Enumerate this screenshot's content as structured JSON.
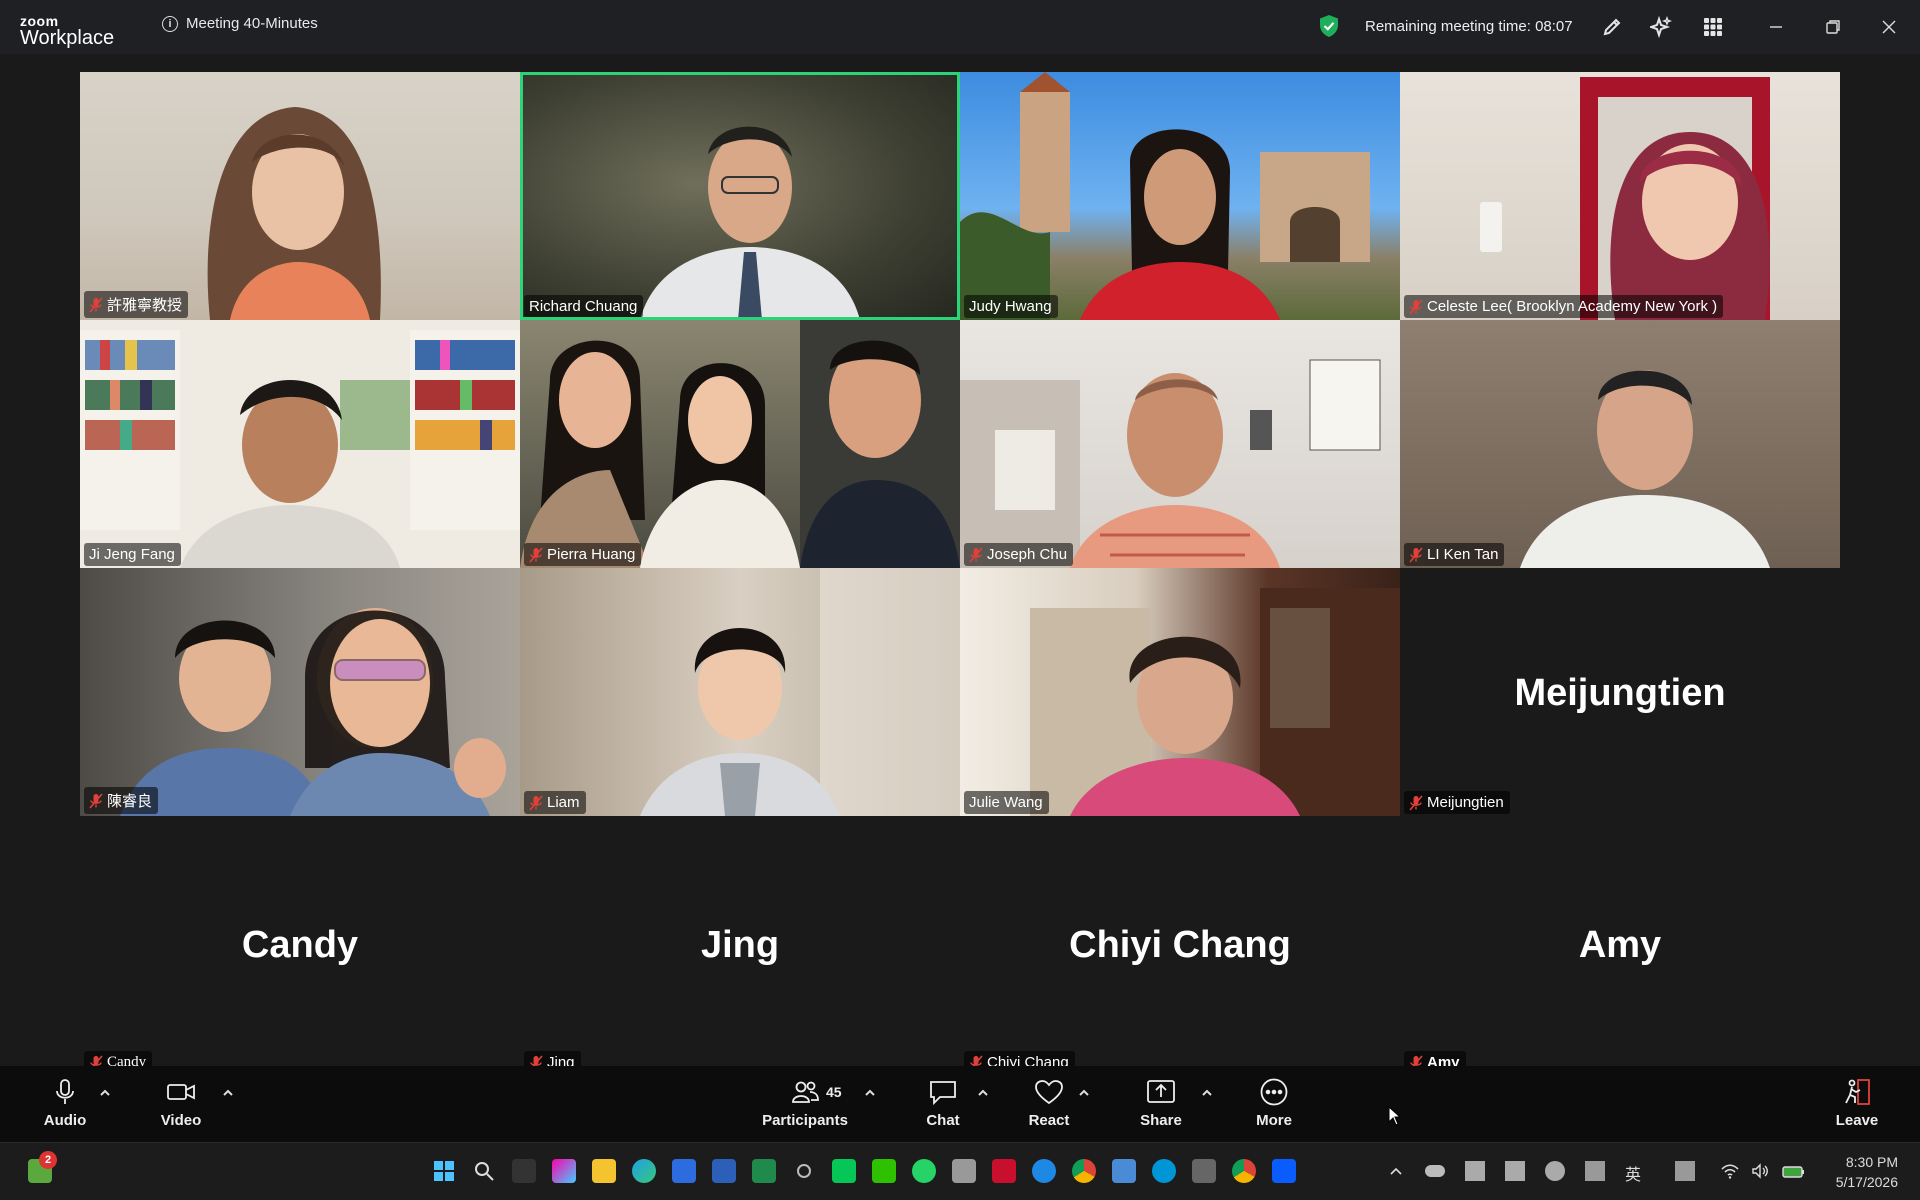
{
  "app": {
    "logo_line1": "zoom",
    "logo_line2": "Workplace"
  },
  "header": {
    "meeting_title": "Meeting 40-Minutes",
    "remaining_time": "Remaining meeting time: 08:07"
  },
  "participants_grid": [
    {
      "name": "許雅寧教授",
      "muted": true
    },
    {
      "name": "Richard Chuang",
      "muted": false,
      "active_speaker": true
    },
    {
      "name": "Judy Hwang",
      "muted": false
    },
    {
      "name": "Celeste Lee( Brooklyn Academy New York )",
      "muted": true
    },
    {
      "name": "Ji Jeng Fang",
      "muted": false
    },
    {
      "name": "Pierra Huang",
      "muted": true
    },
    {
      "name": "Joseph Chu",
      "muted": true
    },
    {
      "name": "LI Ken Tan",
      "muted": true
    },
    {
      "name": "陳睿良",
      "muted": true
    },
    {
      "name": "Liam",
      "muted": true
    },
    {
      "name": "Julie Wang",
      "muted": false
    },
    {
      "name": "Meijungtien",
      "muted": true,
      "video_off": true,
      "display_name": "Meijungtien"
    }
  ],
  "participants_row4": [
    {
      "name": "Candy",
      "display_name": "Candy",
      "muted": true
    },
    {
      "name": "Jing",
      "display_name": "Jing",
      "muted": true
    },
    {
      "name": "Chiyi Chang",
      "display_name": "Chiyi Chang",
      "muted": true
    },
    {
      "name": "Amy",
      "display_name": "Amy",
      "muted": true
    }
  ],
  "toolbar": {
    "audio_label": "Audio",
    "video_label": "Video",
    "participants_label": "Participants",
    "participants_count": "45",
    "chat_label": "Chat",
    "react_label": "React",
    "share_label": "Share",
    "more_label": "More",
    "leave_label": "Leave"
  },
  "taskbar": {
    "notification_count": "2",
    "time": "8:30 PM",
    "date": "5/17/2026",
    "ime": "英"
  },
  "colors": {
    "active_border": "#2cd478",
    "mute_red": "#e0413a",
    "leave_red": "#e0413a"
  }
}
